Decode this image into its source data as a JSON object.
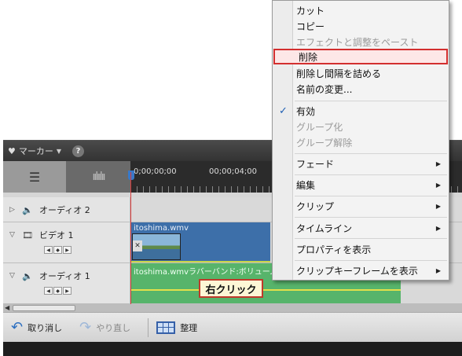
{
  "toolbar": {
    "marker_label": "マーカー",
    "help": "?"
  },
  "ruler": {
    "timecodes": [
      "0;00;00;00",
      "00;00;04;00"
    ]
  },
  "tracks": {
    "audio2": {
      "name": "オーディオ 2"
    },
    "video1": {
      "name": "ビデオ 1",
      "clip_name": "itoshima.wmv"
    },
    "audio1": {
      "name": "オーディオ 1",
      "clip_name": "itoshima.wmvラバーバンド:ボリューム:"
    }
  },
  "callout": {
    "text": "右クリック"
  },
  "bottom_bar": {
    "undo_label": "取り消し",
    "redo_label": "やり直し",
    "organize_label": "整理"
  },
  "context_menu": {
    "items": [
      {
        "label": "カット",
        "enabled": true
      },
      {
        "label": "コピー",
        "enabled": true
      },
      {
        "label": "エフェクトと調整をペースト",
        "enabled": false
      },
      {
        "label": "削除",
        "enabled": true,
        "highlighted": true
      },
      {
        "label": "削除し間隔を詰める",
        "enabled": true
      },
      {
        "label": "名前の変更...",
        "enabled": true
      },
      {
        "label": "有効",
        "enabled": true,
        "checked": true
      },
      {
        "label": "グループ化",
        "enabled": false
      },
      {
        "label": "グループ解除",
        "enabled": false
      },
      {
        "label": "フェード",
        "enabled": true,
        "submenu": true
      },
      {
        "label": "編集",
        "enabled": true,
        "submenu": true
      },
      {
        "label": "クリップ",
        "enabled": true,
        "submenu": true
      },
      {
        "label": "タイムライン",
        "enabled": true,
        "submenu": true
      },
      {
        "label": "プロパティを表示",
        "enabled": true
      },
      {
        "label": "クリップキーフレームを表示",
        "enabled": true,
        "submenu": true
      }
    ]
  },
  "colors": {
    "highlight_border": "#d32f2f",
    "callout_border": "#c0392b",
    "video_clip": "#3d6fa9",
    "audio_clip": "#57b46b",
    "playhead": "#d83a3a"
  }
}
